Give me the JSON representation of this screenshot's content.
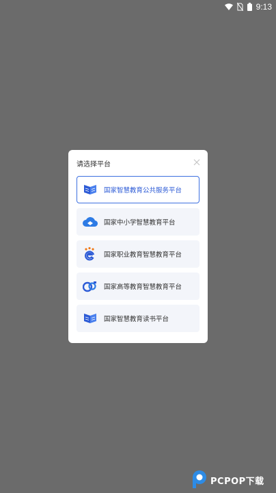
{
  "status_bar": {
    "time": "9:13",
    "icons": [
      "wifi-icon",
      "no-sim-icon",
      "battery-icon"
    ]
  },
  "dialog": {
    "title": "请选择平台",
    "close_icon": "close-icon",
    "options": [
      {
        "label": "国家智慧教育公共服务平台",
        "icon": "open-book-icon",
        "selected": true
      },
      {
        "label": "国家中小学智慧教育平台",
        "icon": "cloud-logo-icon",
        "selected": false
      },
      {
        "label": "国家职业教育智慧教育平台",
        "icon": "e-person-logo-icon",
        "selected": false
      },
      {
        "label": "国家高等教育智慧教育平台",
        "icon": "higher-ed-logo-icon",
        "selected": false
      },
      {
        "label": "国家智慧教育读书平台",
        "icon": "open-book-icon",
        "selected": false
      }
    ]
  },
  "watermark": {
    "text": "PCPOP下载"
  },
  "colors": {
    "overlay": "#6b6b6b",
    "accent": "#3c6fe0",
    "option_bg": "#f3f5fa"
  }
}
